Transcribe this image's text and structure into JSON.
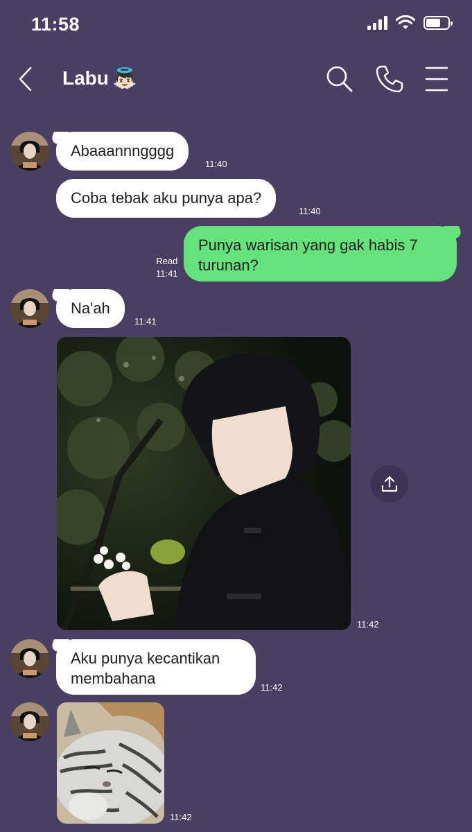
{
  "status_bar": {
    "time": "11:58"
  },
  "header": {
    "title": "Labu",
    "title_emoji": "👼🏻",
    "icons": [
      "back-icon",
      "search-icon",
      "phone-icon",
      "menu-icon"
    ]
  },
  "messages": [
    {
      "from": "other",
      "type": "text",
      "text": "Abaaannngggg",
      "time": "11:40"
    },
    {
      "from": "other",
      "type": "text",
      "text": "Coba tebak aku punya apa?",
      "time": "11:40"
    },
    {
      "from": "me",
      "type": "text",
      "text": "Punya warisan yang gak habis 7 turunan?",
      "status": "Read",
      "time": "11:41"
    },
    {
      "from": "other",
      "type": "text",
      "text": "Na'ah",
      "time": "11:41"
    },
    {
      "from": "other",
      "type": "image",
      "time": "11:42"
    },
    {
      "from": "other",
      "type": "text",
      "text": "Aku punya kecantikan membahana",
      "time": "11:42"
    },
    {
      "from": "other",
      "type": "image",
      "time": "11:42"
    }
  ],
  "colors": {
    "background": "#483f62",
    "incoming_bubble": "#ffffff",
    "outgoing_bubble": "#66e27d"
  }
}
